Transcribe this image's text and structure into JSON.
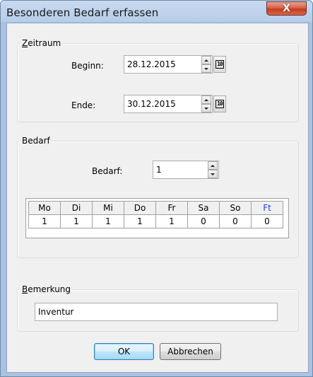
{
  "window": {
    "title": "Besonderen Bedarf erfassen",
    "close_glyph": "X"
  },
  "zeitraum": {
    "group_label": "Zeitraum",
    "group_label_underline": "Z",
    "group_label_rest": "eitraum",
    "beginn_label": "Beginn:",
    "beginn_value": "28.12.2015",
    "ende_label": "Ende:",
    "ende_value": "30.12.2015",
    "calendar_glyph": "10"
  },
  "bedarf": {
    "group_label": "Bedarf",
    "field_label": "Bedarf:",
    "field_value": "1",
    "table": {
      "headers": [
        "Mo",
        "Di",
        "Mi",
        "Do",
        "Fr",
        "Sa",
        "So",
        "Ft"
      ],
      "row": [
        "1",
        "1",
        "1",
        "1",
        "1",
        "0",
        "0",
        "0"
      ]
    }
  },
  "bemerkung": {
    "group_label": "Bemerkung",
    "group_label_underline": "B",
    "group_label_rest": "emerkung",
    "value": "Inventur"
  },
  "buttons": {
    "ok_label": "OK",
    "cancel_label": "Abbrechen"
  },
  "colors": {
    "ft_header": "#1f3bd1",
    "close_button": "#c33c22"
  }
}
